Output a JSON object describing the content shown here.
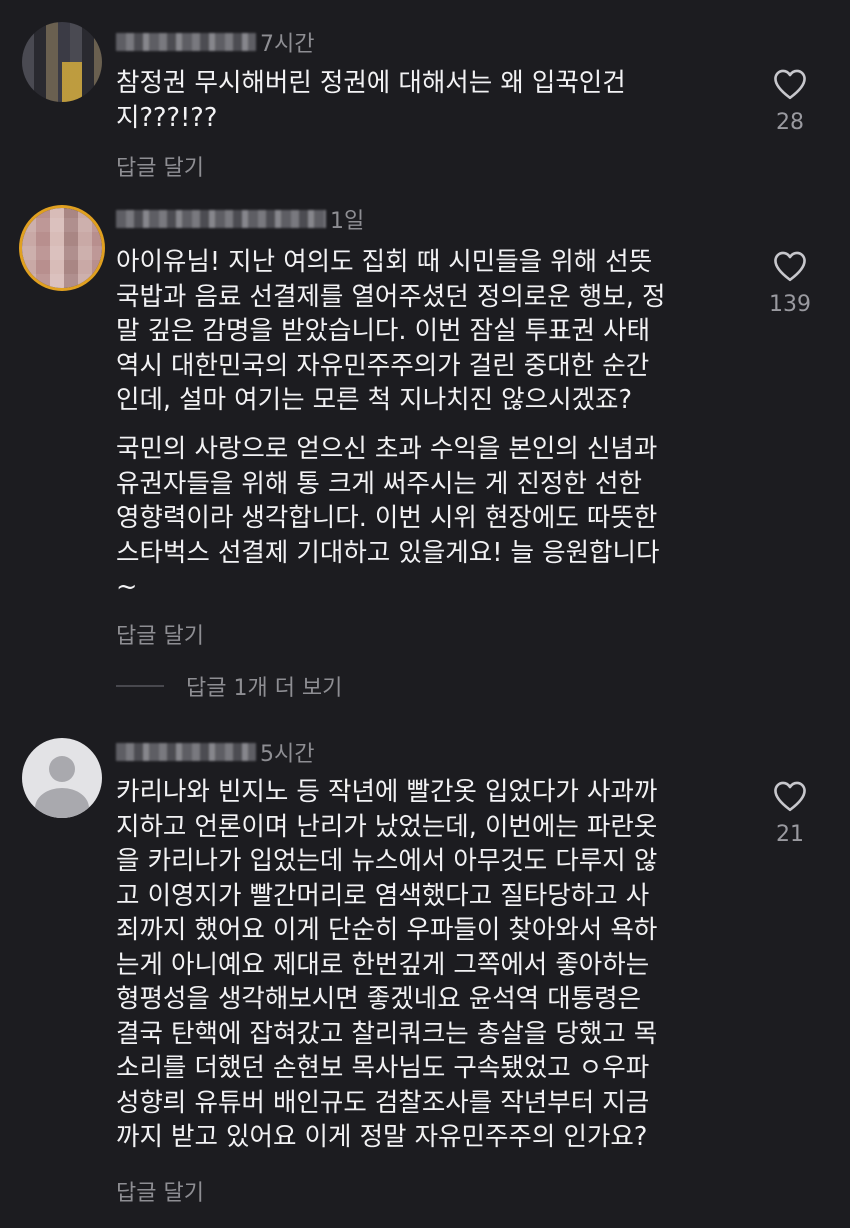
{
  "comments": [
    {
      "username": "",
      "time": "7시간",
      "text": "참정권 무시해버린 정권에 대해서는 왜 입꾹인건\n지???!??",
      "likes": "28",
      "reply_label": "답글 달기"
    },
    {
      "username": "",
      "time": "1일",
      "text": "아이유님! 지난 여의도 집회 때 시민들을 위해 선뜻\n국밥과 음료 선결제를 열어주셨던 정의로운 행보, 정\n말 깊은 감명을 받았습니다. 이번 잠실 투표권 사태\n역시 대한민국의 자유민주주의가 걸린 중대한 순간\n인데, 설마 여기는 모른 척 지나치진 않으시겠죠?",
      "text2": "국민의 사랑으로 얻으신 초과 수익을 본인의 신념과\n유권자들을 위해 통 크게 써주시는 게 진정한 선한\n영향력이라 생각합니다. 이번 시위 현장에도 따뜻한\n스타벅스 선결제 기대하고 있을게요! 늘 응원합니다\n~",
      "likes": "139",
      "reply_label": "답글 달기",
      "more_replies_label": "답글 1개 더 보기"
    },
    {
      "username": "",
      "time": "5시간",
      "text": "카리나와 빈지노 등 작년에 빨간옷 입었다가 사과까\n지하고 언론이며 난리가 났었는데, 이번에는 파란옷\n을 카리나가 입었는데 뉴스에서 아무것도 다루지 않\n고 이영지가 빨간머리로 염색했다고 질타당하고 사\n죄까지 했어요 이게 단순히 우파들이 찾아와서 욕하\n는게 아니예요 제대로 한번깊게 그쪽에서 좋아하는\n형평성을 생각해보시면 좋겠네요 윤석역 대통령은\n결국 탄핵에 잡혀갔고 찰리쿼크는 총살을 당했고 목\n소리를 더했던 손현보 목사님도 구속됐었고 ㅇ우파\n성향릐 유튜버 배인규도 검찰조사를 작년부터 지금\n까지 받고 있어요 이게 정말 자유민주주의 인가요?",
      "likes": "21",
      "reply_label": "답글 달기"
    }
  ],
  "icons": {
    "like": "heart-outline-icon",
    "avatar_default": "default-user-icon"
  },
  "colors": {
    "background": "#1c1c20",
    "text": "#f2f2f4",
    "muted": "#8e8e93",
    "story_ring": "#e0a020"
  }
}
